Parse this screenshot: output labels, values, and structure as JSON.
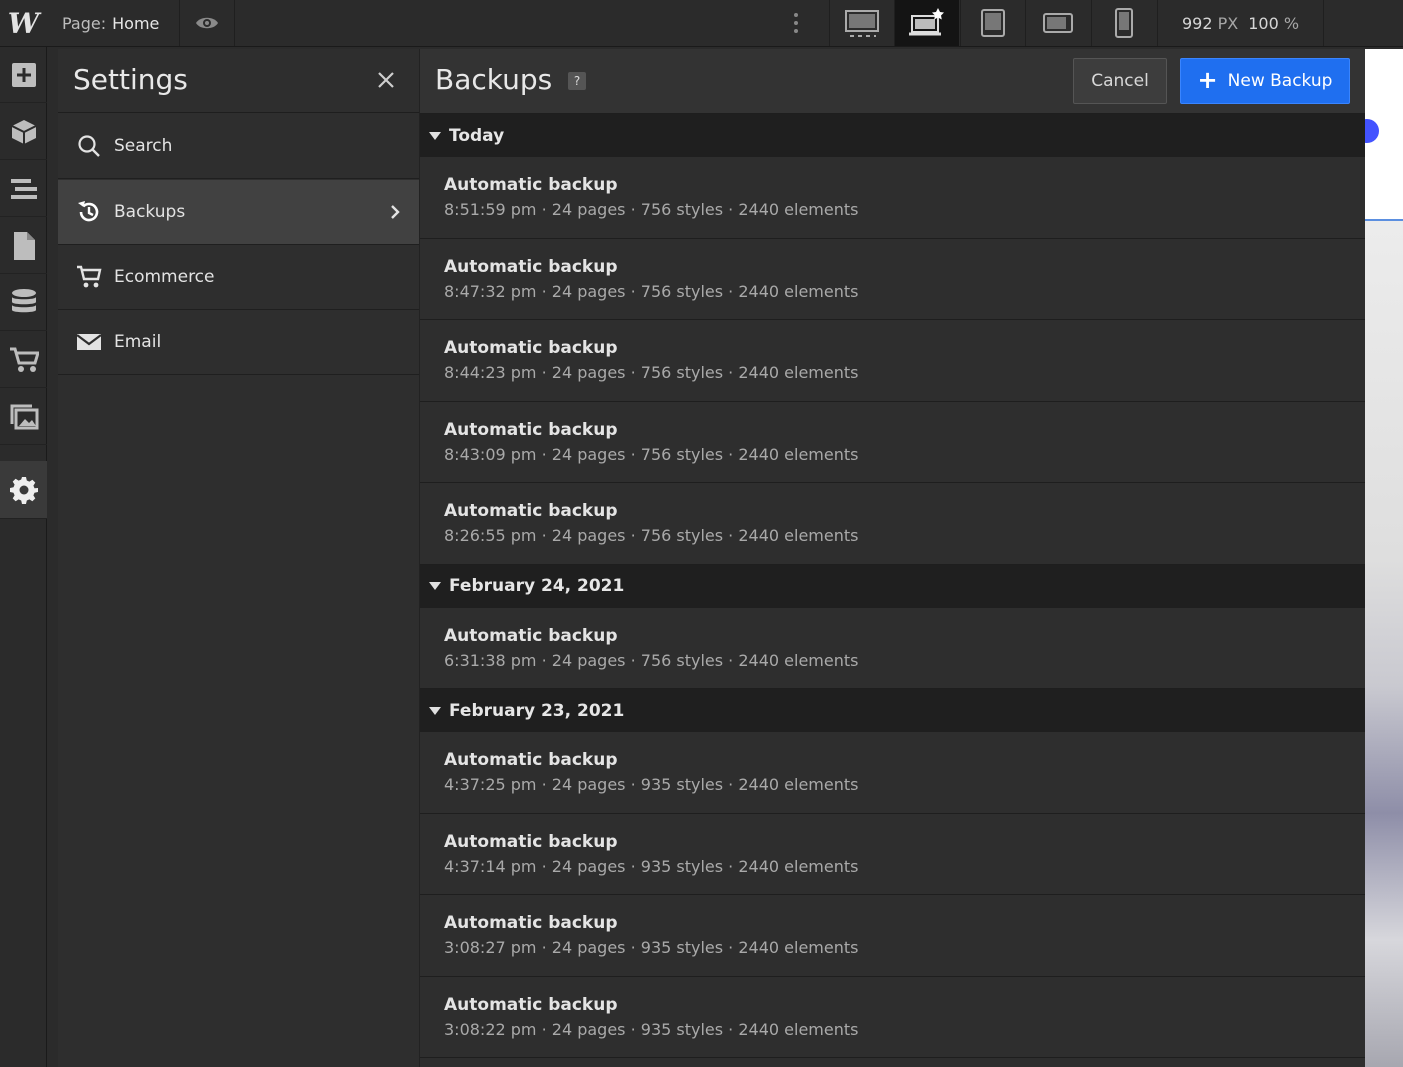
{
  "topbar": {
    "logo": "W",
    "page_label": "Page:",
    "page_value": "Home",
    "width_value": "992",
    "width_unit": "PX",
    "zoom_value": "100",
    "zoom_unit": "%"
  },
  "settings": {
    "title": "Settings",
    "items": [
      {
        "label": "Search",
        "icon": "search-icon"
      },
      {
        "label": "Backups",
        "icon": "backup-history-icon",
        "active": true
      },
      {
        "label": "Ecommerce",
        "icon": "cart-icon"
      },
      {
        "label": "Email",
        "icon": "envelope-icon"
      }
    ]
  },
  "backups": {
    "title": "Backups",
    "help": "?",
    "cancel_label": "Cancel",
    "new_label": "New Backup",
    "groups": [
      {
        "label": "Today",
        "rows": [
          {
            "title": "Automatic backup",
            "meta": "8:51:59 pm · 24 pages · 756 styles · 2440 elements"
          },
          {
            "title": "Automatic backup",
            "meta": "8:47:32 pm · 24 pages · 756 styles · 2440 elements"
          },
          {
            "title": "Automatic backup",
            "meta": "8:44:23 pm · 24 pages · 756 styles · 2440 elements"
          },
          {
            "title": "Automatic backup",
            "meta": "8:43:09 pm · 24 pages · 756 styles · 2440 elements"
          },
          {
            "title": "Automatic backup",
            "meta": "8:26:55 pm · 24 pages · 756 styles · 2440 elements"
          }
        ]
      },
      {
        "label": "February 24, 2021",
        "rows": [
          {
            "title": "Automatic backup",
            "meta": "6:31:38 pm · 24 pages · 756 styles · 2440 elements"
          }
        ]
      },
      {
        "label": "February 23, 2021",
        "rows": [
          {
            "title": "Automatic backup",
            "meta": "4:37:25 pm · 24 pages · 935 styles · 2440 elements"
          },
          {
            "title": "Automatic backup",
            "meta": "4:37:14 pm · 24 pages · 935 styles · 2440 elements"
          },
          {
            "title": "Automatic backup",
            "meta": "3:08:27 pm · 24 pages · 935 styles · 2440 elements"
          },
          {
            "title": "Automatic backup",
            "meta": "3:08:22 pm · 24 pages · 935 styles · 2440 elements"
          }
        ]
      }
    ]
  },
  "colors": {
    "accent": "#1f6ff0",
    "panel": "#2e2e2e",
    "group_header": "#1f1f1f"
  }
}
